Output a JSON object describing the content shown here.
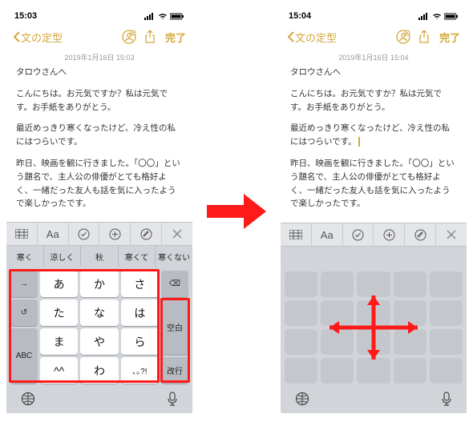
{
  "left": {
    "status_time": "15:03",
    "nav_back": "文の定型",
    "nav_done": "完了",
    "datestamp": "2019年1月16日 15:03",
    "note": {
      "p1": "タロウさんへ",
      "p2": "こんにちは。お元気ですか？私は元気です。お手紙をありがとう。",
      "p3": "最近めっきり寒くなったけど、冷え性の私にはつらいです。",
      "p4": "昨日、映画を観に行きました。「〇〇」という題名で、主人公の俳優がとても格好よく、一緒だった友人も話を気に入ったようで楽しかったです。"
    },
    "suggest": [
      "寒く",
      "涼しく",
      "秋",
      "寒くて",
      "寒くない"
    ],
    "keys": {
      "arrow": "→",
      "a": "あ",
      "ka": "か",
      "sa": "さ",
      "ta": "た",
      "na": "な",
      "ha": "は",
      "ma": "ま",
      "ya": "や",
      "ra": "ら",
      "face": "^^",
      "wa": "わ",
      "punct": "､｡?!",
      "undo": "↺",
      "abc": "ABC",
      "del": "⌫",
      "space": "空白",
      "enter": "改行"
    }
  },
  "right": {
    "status_time": "15:04",
    "nav_back": "文の定型",
    "nav_done": "完了",
    "datestamp": "2019年1月16日 15:04",
    "note": {
      "p1": "タロウさんへ",
      "p2": "こんにちは。お元気ですか？私は元気です。お手紙をありがとう。",
      "p3": "最近めっきり寒くなったけど、冷え性の私にはつらいです。",
      "p4": "昨日、映画を観に行きました。「〇〇」という題名で、主人公の俳優がとても格好よく、一緒だった友人も話を気に入ったようで楽しかったです。"
    }
  },
  "toolbar_aa": "Aa"
}
